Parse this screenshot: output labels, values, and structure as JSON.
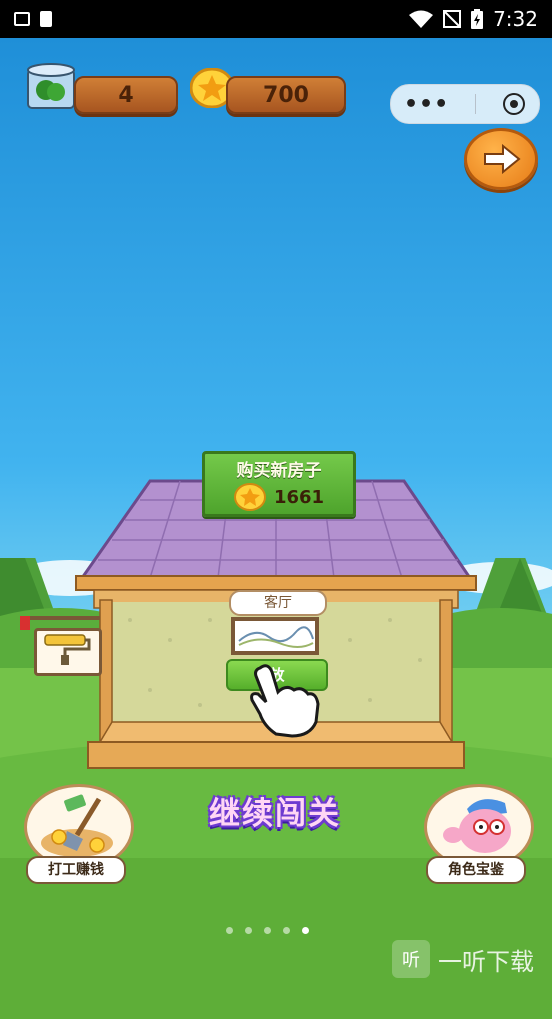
{
  "status": {
    "time": "7:32"
  },
  "resources": {
    "leaves": "4",
    "coins": "700"
  },
  "buy_house": {
    "title": "购买新房子",
    "price": "1661"
  },
  "room": {
    "label": "客厅",
    "action": "放"
  },
  "buttons": {
    "work": "打工赚钱",
    "characters": "角色宝鉴",
    "continue": "继续闯关"
  },
  "pagination": {
    "count": 5,
    "active": 5
  },
  "watermark": {
    "icon_text": "听",
    "text": "一听下载"
  },
  "colors": {
    "sky": "#2fa0dd",
    "grass": "#67b946",
    "roof": "#b391cf",
    "wood": "#d9a259"
  }
}
